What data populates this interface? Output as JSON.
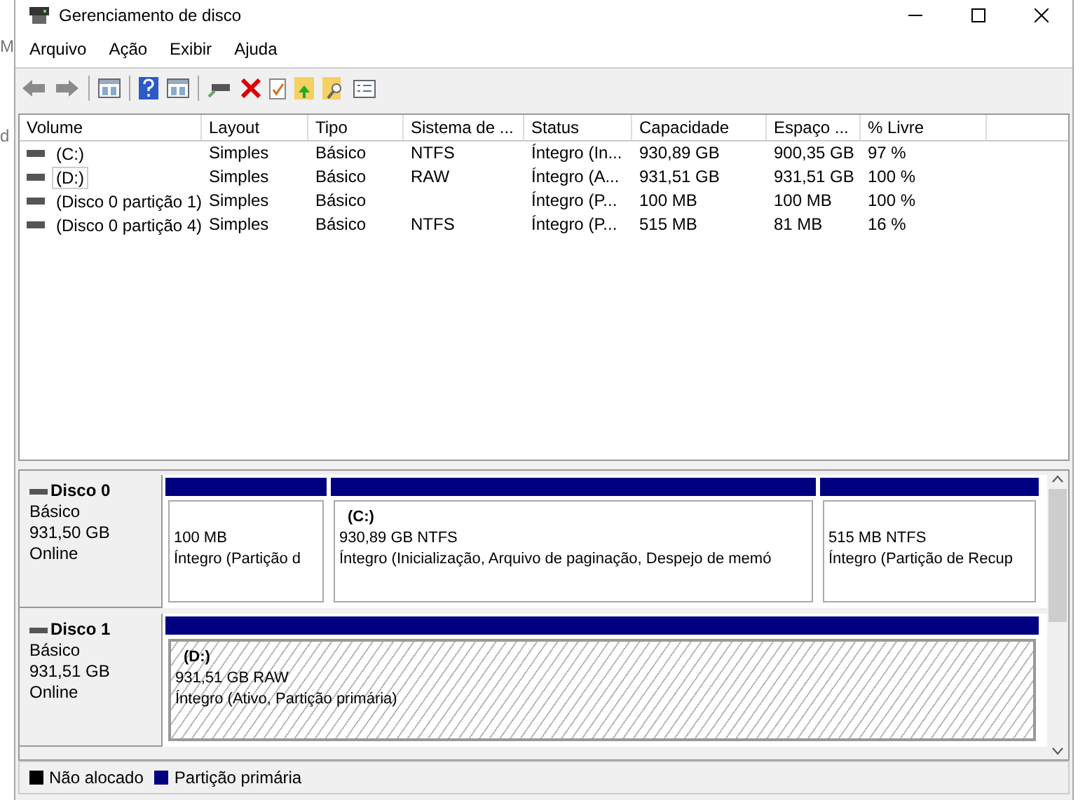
{
  "background_fragments": [
    "M",
    "d"
  ],
  "window": {
    "title": "Gerenciamento de disco"
  },
  "menu": [
    "Arquivo",
    "Ação",
    "Exibir",
    "Ajuda"
  ],
  "volume_table": {
    "columns": [
      "Volume",
      "Layout",
      "Tipo",
      "Sistema de ...",
      "Status",
      "Capacidade",
      "Espaço ...",
      "% Livre"
    ],
    "rows": [
      {
        "cells": [
          "(C:)",
          "Simples",
          "Básico",
          "NTFS",
          "Íntegro (In...",
          "930,89 GB",
          "900,35 GB",
          "97 %"
        ],
        "selected": false
      },
      {
        "cells": [
          "(D:)",
          "Simples",
          "Básico",
          "RAW",
          "Íntegro (A...",
          "931,51 GB",
          "931,51 GB",
          "100 %"
        ],
        "selected": true
      },
      {
        "cells": [
          "(Disco 0 partição 1)",
          "Simples",
          "Básico",
          "",
          "Íntegro (P...",
          "100 MB",
          "100 MB",
          "100 %"
        ],
        "selected": false
      },
      {
        "cells": [
          "(Disco 0 partição 4)",
          "Simples",
          "Básico",
          "NTFS",
          "Íntegro (P...",
          "515 MB",
          "81 MB",
          "16 %"
        ],
        "selected": false
      }
    ]
  },
  "disks": [
    {
      "name": "Disco 0",
      "type": "Básico",
      "size": "931,50 GB",
      "status": "Online",
      "partitions": [
        {
          "size": "100 MB",
          "status": "Íntegro (Partição d",
          "selected": false
        },
        {
          "label": "(C:)",
          "size": "930,89 GB NTFS",
          "status": "Íntegro (Inicialização, Arquivo de paginação, Despejo de memó",
          "selected": false
        },
        {
          "size": "515 MB NTFS",
          "status": "Íntegro (Partição de Recup",
          "selected": false
        }
      ]
    },
    {
      "name": "Disco 1",
      "type": "Básico",
      "size": "931,51 GB",
      "status": "Online",
      "partitions": [
        {
          "label": "(D:)",
          "size": "931,51 GB RAW",
          "status": "Íntegro (Ativo, Partição primária)",
          "selected": true
        }
      ]
    }
  ],
  "legend": [
    {
      "label": "Não alocado",
      "color": "#000000"
    },
    {
      "label": "Partição primária",
      "color": "#000080"
    }
  ]
}
